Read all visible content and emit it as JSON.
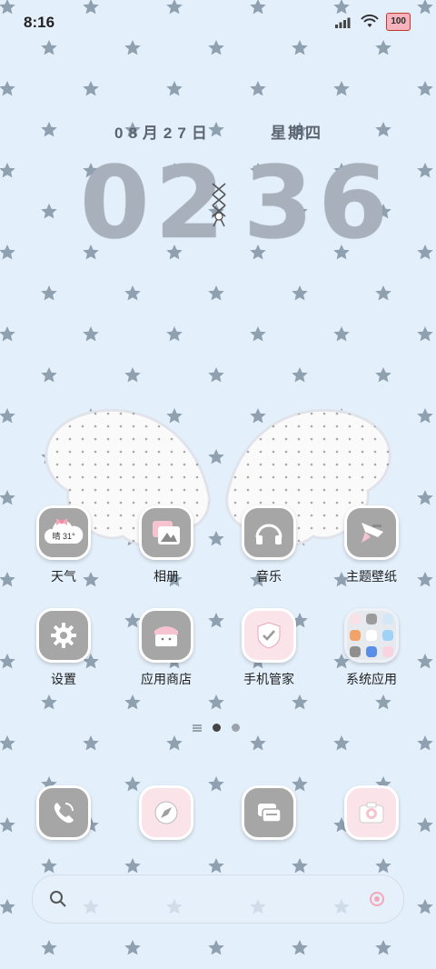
{
  "status_bar": {
    "time": "8:16",
    "battery": "100"
  },
  "clock_widget": {
    "date": "08月27日",
    "weekday": "星期四",
    "hour": "02",
    "minute": "36"
  },
  "apps": [
    {
      "id": "weather",
      "label": "天气",
      "weather_text": "晴 31°"
    },
    {
      "id": "gallery",
      "label": "相册"
    },
    {
      "id": "music",
      "label": "音乐"
    },
    {
      "id": "themes",
      "label": "主题壁纸"
    },
    {
      "id": "settings",
      "label": "设置"
    },
    {
      "id": "appstore",
      "label": "应用商店"
    },
    {
      "id": "phone-manager",
      "label": "手机管家"
    },
    {
      "id": "system-apps",
      "label": "系统应用"
    }
  ],
  "dock": [
    {
      "id": "phone"
    },
    {
      "id": "browser"
    },
    {
      "id": "messages"
    },
    {
      "id": "camera"
    }
  ],
  "colors": {
    "star": "#8fa0b0",
    "wallpaper": "#e3effa",
    "icon_gray": "#a6a6a6",
    "icon_pink": "#fbe3ea"
  },
  "page_indicator": {
    "pages": 2,
    "current": 1
  }
}
